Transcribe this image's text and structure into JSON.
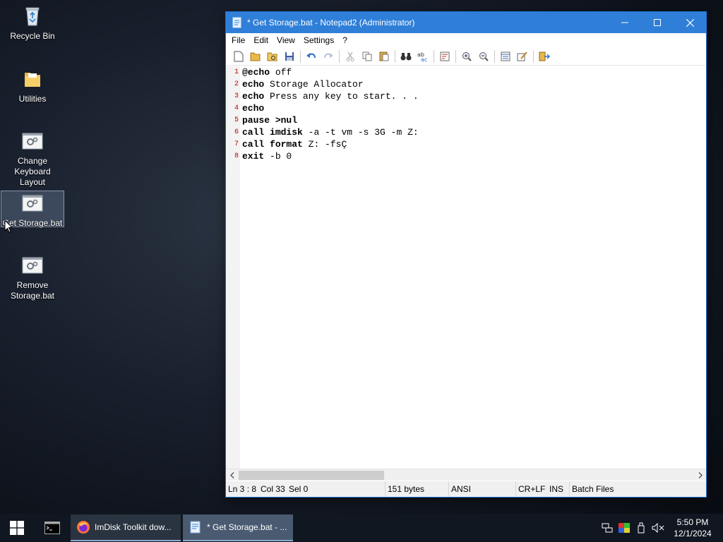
{
  "desktop": {
    "icons": [
      {
        "label": "Recycle Bin"
      },
      {
        "label": "Utilities"
      },
      {
        "label": "Change Keyboard Layout"
      },
      {
        "label": "Get Storage.bat"
      },
      {
        "label": "Remove Storage.bat"
      }
    ]
  },
  "window": {
    "title": "* Get Storage.bat - Notepad2 (Administrator)",
    "menu": [
      "File",
      "Edit",
      "View",
      "Settings",
      "?"
    ],
    "lines": [
      {
        "num": "1",
        "kw": "@echo",
        "rest": " off"
      },
      {
        "num": "2",
        "kw": "echo",
        "rest": " Storage Allocator"
      },
      {
        "num": "3",
        "kw": "echo",
        "rest": " Press any key to start. . ."
      },
      {
        "num": "4",
        "kw": "echo",
        "rest": ""
      },
      {
        "num": "5",
        "kw": "pause",
        "rest": " >nul",
        "bold_rest": true
      },
      {
        "num": "6",
        "kw": "call",
        "kw2": "imdisk",
        "rest": " -a -t vm -s 3G -m Z:"
      },
      {
        "num": "7",
        "kw": "call",
        "kw2": "format",
        "rest": " Z: -fsÇ"
      },
      {
        "num": "8",
        "kw": "exit",
        "rest": " -b 0"
      }
    ],
    "status": {
      "pos": "Ln 3 : 8",
      "col": "Col 33",
      "sel": "Sel 0",
      "bytes": "151 bytes",
      "encoding": "ANSI",
      "eol": "CR+LF",
      "ins": "INS",
      "scheme": "Batch Files"
    }
  },
  "taskbar": {
    "tasks": [
      {
        "label": "ImDisk Toolkit dow..."
      },
      {
        "label": "* Get Storage.bat - ..."
      }
    ],
    "time": "5:50 PM",
    "date": "12/1/2024"
  },
  "colors": {
    "titlebar": "#2f7fd8",
    "line_numbers": "#c00000",
    "taskbar": "#101720"
  }
}
